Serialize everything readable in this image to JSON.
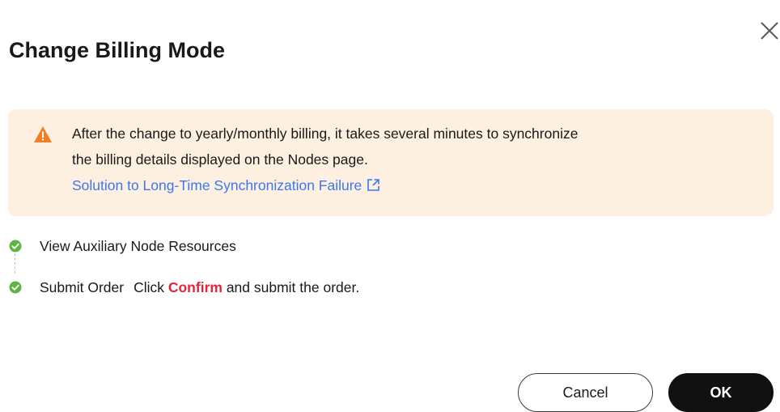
{
  "dialog": {
    "title": "Change Billing Mode",
    "close_icon": "close-icon"
  },
  "alert": {
    "icon": "warning-triangle-icon",
    "icon_color": "#f27d29",
    "background": "#fdf0e1",
    "line1": "After the change to yearly/monthly billing, it takes several minutes to synchronize",
    "line2": "the billing details displayed on the Nodes page.",
    "link_text": "Solution to Long-Time Synchronization Failure",
    "link_icon": "external-link-icon",
    "link_color": "#3a78f2"
  },
  "steps": [
    {
      "icon": "check-circle-icon",
      "title": "View Auxiliary Node Resources"
    },
    {
      "icon": "check-circle-icon",
      "title": "Submit Order",
      "desc_prefix": "Click",
      "desc_emphasis": "Confirm",
      "desc_suffix": "and submit the order."
    }
  ],
  "colors": {
    "step_done": "#5eb544",
    "emphasis": "#e0263a"
  },
  "footer": {
    "cancel_label": "Cancel",
    "ok_label": "OK"
  }
}
